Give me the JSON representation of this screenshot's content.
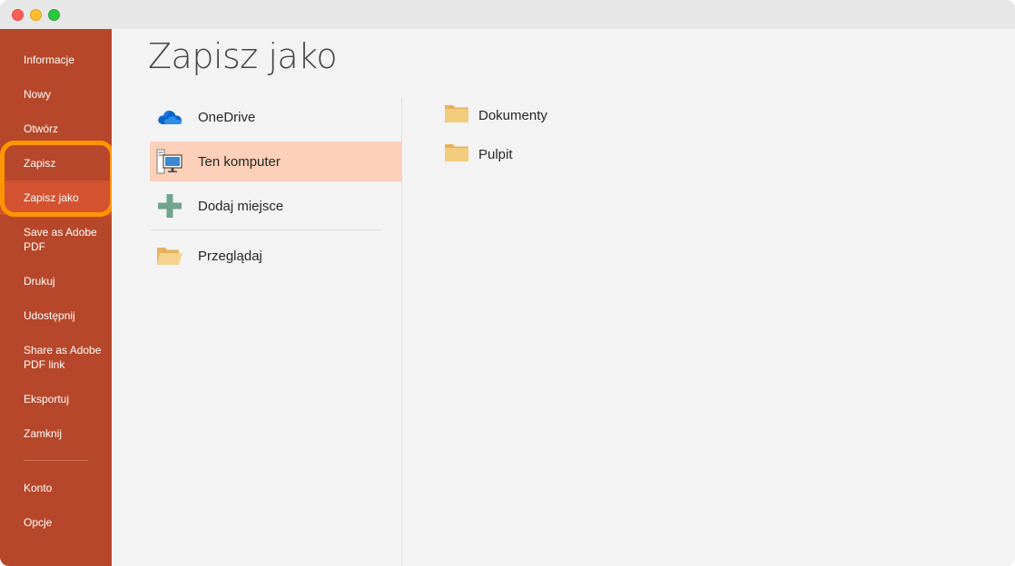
{
  "window": {
    "controls": [
      "close",
      "minimize",
      "maximize"
    ]
  },
  "sidebar": {
    "items": [
      {
        "label": "Informacje"
      },
      {
        "label": "Nowy"
      },
      {
        "label": "Otwórz"
      },
      {
        "label": "Zapisz"
      },
      {
        "label": "Zapisz jako",
        "selected": true
      },
      {
        "label": "Save as Adobe PDF"
      },
      {
        "label": "Drukuj"
      },
      {
        "label": "Udostępnij"
      },
      {
        "label": "Share as Adobe PDF link"
      },
      {
        "label": "Eksportuj"
      },
      {
        "label": "Zamknij"
      },
      {
        "label": "Konto"
      },
      {
        "label": "Opcje"
      }
    ]
  },
  "main": {
    "title": "Zapisz jako",
    "locations": [
      {
        "label": "OneDrive",
        "icon": "onedrive-cloud-icon"
      },
      {
        "label": "Ten komputer",
        "icon": "computer-icon",
        "selected": true
      },
      {
        "label": "Dodaj miejsce",
        "icon": "plus-icon"
      },
      {
        "label": "Przeglądaj",
        "icon": "open-folder-icon"
      }
    ],
    "folders": [
      {
        "label": "Dokumenty",
        "icon": "folder-icon"
      },
      {
        "label": "Pulpit",
        "icon": "folder-icon"
      }
    ]
  },
  "colors": {
    "sidebar_bg": "#b7472a",
    "sidebar_selected": "#d35230",
    "highlight_ring": "#ff9500",
    "location_selected": "#fcd0b9",
    "folder": "#f2cc7c"
  }
}
